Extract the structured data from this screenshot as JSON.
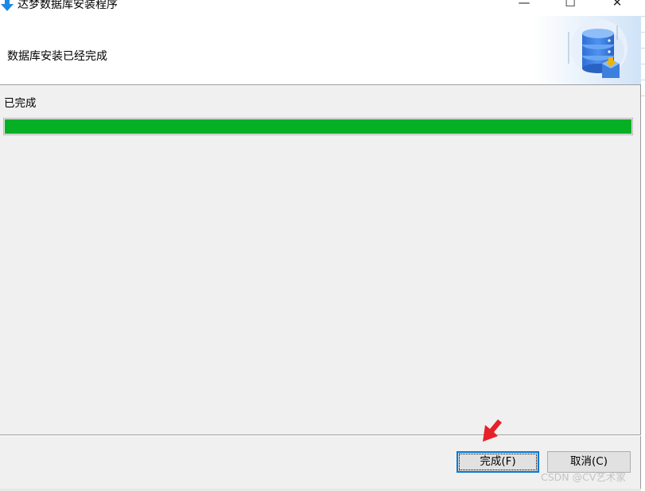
{
  "window": {
    "title": "达梦数据库安装程序",
    "controls": {
      "minimize": "—",
      "maximize": "☐",
      "close": "✕"
    }
  },
  "header": {
    "title": "数据库安装已经完成"
  },
  "main": {
    "status_label": "已完成",
    "progress_percent": 100,
    "progress_color": "#06b025"
  },
  "footer": {
    "finish_label": "完成(F)",
    "cancel_label": "取消(C)"
  },
  "watermark": "CSDN @CV艺术家",
  "icons": {
    "app": "download-arrow-icon",
    "header_art": "database-stack-icon",
    "annotation": "red-arrow-pointer"
  },
  "colors": {
    "accent": "#0078d7",
    "progress": "#06b025",
    "database": "#3a7be0",
    "annotation": "#e8202a"
  }
}
